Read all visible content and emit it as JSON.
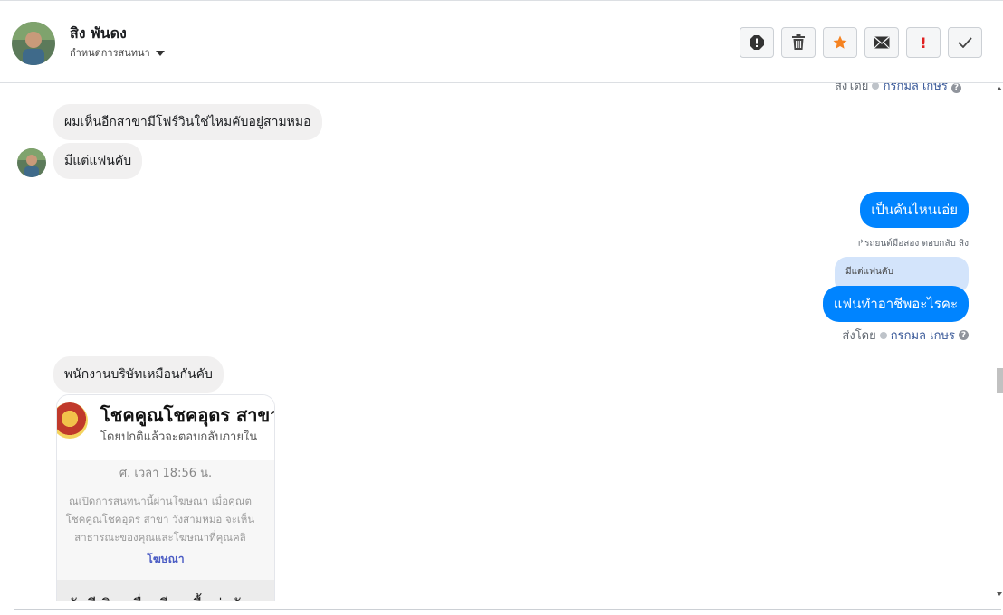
{
  "header": {
    "contact_name": "สิง พันดง",
    "conversation_menu": "กำหนดการสนทนา",
    "actions": [
      {
        "icon": "alert-circle-icon",
        "label": "!"
      },
      {
        "icon": "trash-icon",
        "label": ""
      },
      {
        "icon": "star-icon",
        "label": ""
      },
      {
        "icon": "envelope-icon",
        "label": ""
      },
      {
        "icon": "exclamation-icon",
        "label": "!"
      },
      {
        "icon": "check-icon",
        "label": "✓"
      }
    ]
  },
  "chat": {
    "top_cut_text": "ส่งโดย",
    "top_cut_link": "กรกมล เกษร",
    "messages_in": [
      {
        "text": "ผมเห็นอีกสาขามีโฟร์วินใช่ไหมคับอยู่สามหมอ"
      },
      {
        "text": "มีแต่แฟนคับ"
      },
      {
        "text": "พนักงานบริษัทเหมือนกันคับ"
      }
    ],
    "messages_out": [
      {
        "text": "เป็นคันไหนเอ่ย"
      },
      {
        "text": "แฟนทำอาชีพอะไรคะ"
      }
    ],
    "reply_meta": "รถยนต์มือสอง ตอบกลับ สิง",
    "quoted_text": "มีแต่แฟนคับ",
    "sent_by_label": "ส่งโดย",
    "sent_by_name": "กรกมล เกษร",
    "attachment": {
      "title": "โชคคูณโชคอุดร สาขา",
      "subtitle": "โดยปกติแล้วจะตอบกลับภายใน",
      "time": "ศ. เวลา 18:56 น.",
      "line1": "ณเปิดการสนทนานี้ผ่านโฆษณา เมื่อคุณต",
      "line2": "โชคคูณโชคอุดร สาขา วังสามหมอ จะเห็น",
      "line3": "สาธารณะของคุณและโฆษณาที่คุณคลิ",
      "ad_link": "โฆษณา",
      "bottom_text": "สวัสดี สิงเครื่องดี มาลื้นต่อยัง"
    }
  },
  "colors": {
    "primary": "#0084ff",
    "incoming": "#f1f0f0",
    "quoted": "#d3e4fb",
    "link": "#385898",
    "star": "#f58220",
    "alert_red": "#e02020"
  }
}
